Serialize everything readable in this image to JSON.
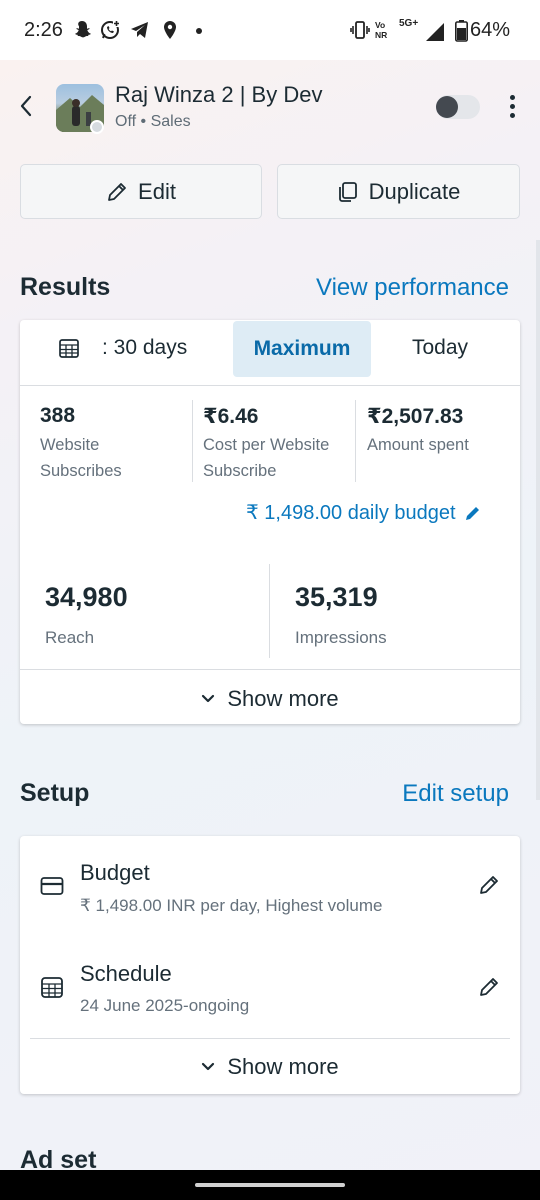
{
  "status_bar": {
    "time": "2:26",
    "network_label_top": "Vo",
    "network_label_bottom": "NR",
    "network_type": "5G+",
    "battery": "64%"
  },
  "header": {
    "title": "Raj Winza 2 | By Dev",
    "status": "Off",
    "separator": "•",
    "objective": "Sales",
    "toggle_on": false
  },
  "actions": {
    "edit_label": "Edit",
    "duplicate_label": "Duplicate"
  },
  "results": {
    "title": "Results",
    "link": "View performance",
    "tabs": [
      {
        "label": ": 30 days",
        "active": false
      },
      {
        "label": "Maximum",
        "active": true
      },
      {
        "label": "Today",
        "active": false
      }
    ],
    "metrics": [
      {
        "value": "388",
        "label_line1": "Website",
        "label_line2": "Subscribes"
      },
      {
        "value": "₹6.46",
        "label_line1": "Cost per Website",
        "label_line2": "Subscribe"
      },
      {
        "value": "₹2,507.83",
        "label_line1": "Amount spent",
        "label_line2": ""
      }
    ],
    "daily_budget": "₹ 1,498.00 daily budget",
    "reach": {
      "value": "34,980",
      "label": "Reach"
    },
    "impressions": {
      "value": "35,319",
      "label": "Impressions"
    },
    "show_more": "Show more"
  },
  "setup": {
    "title": "Setup",
    "link": "Edit setup",
    "budget": {
      "title": "Budget",
      "detail": "₹ 1,498.00 INR per day, Highest volume"
    },
    "schedule": {
      "title": "Schedule",
      "detail": "24 June 2025-ongoing"
    },
    "show_more": "Show more"
  },
  "next_section": {
    "title": "Ad set"
  },
  "colors": {
    "accent": "#0a78be",
    "text": "#1c2b33",
    "muted": "#65717c",
    "active_tab_bg": "#deecf5"
  }
}
